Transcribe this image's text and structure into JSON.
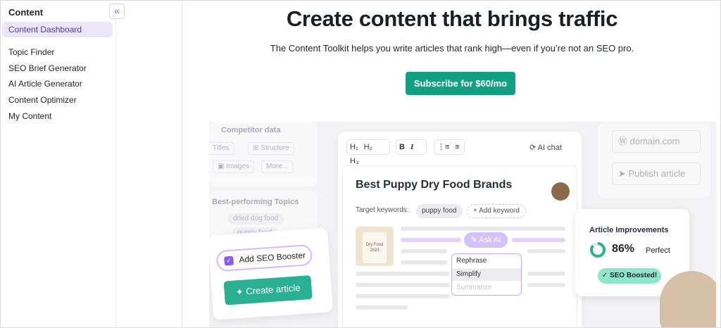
{
  "sidebar": {
    "title": "Content",
    "collapse_icon": "«",
    "active_item": "Content Dashboard",
    "items": [
      "Topic Finder",
      "SEO Brief Generator",
      "AI Article Generator",
      "Content Optimizer",
      "My Content"
    ]
  },
  "hero": {
    "title": "Create content that brings traffic",
    "subtitle": "The Content Toolkit helps you write articles that rank high—even if you’re not an SEO pro.",
    "cta": "Subscribe for $60/mo"
  },
  "illustration": {
    "competitor": {
      "heading": "Competitor data",
      "chips": [
        "Titles",
        "Structure",
        "Images",
        "More..."
      ]
    },
    "topics": {
      "heading": "Best-performing Topics",
      "tags": [
        "dried dog food",
        "puppy food"
      ]
    },
    "booster": {
      "checkbox_label": "Add SEO Booster",
      "button": "Create article"
    },
    "toolbar": {
      "h1": "H₁",
      "h2": "H₂",
      "h3": "H₃",
      "bold": "B",
      "italic": "I",
      "ai_chat": "AI chat"
    },
    "editor": {
      "title": "Best Puppy Dry Food Brands",
      "keywords_label": "Target keywords:",
      "keyword": "puppy food",
      "add_keyword": "+ Add keyword",
      "ask_ai": "Ask AI",
      "menu": [
        "Rephrase",
        "Simplify",
        "Summarize"
      ],
      "image_text": "Dry Food 2023"
    },
    "right": {
      "domain": "domain.com",
      "publish": "Publish article"
    },
    "improvements": {
      "heading": "Article Improvements",
      "score": "86%",
      "score_label": "Perfect",
      "badge": "SEO Boosted!",
      "score_value": 0.86
    }
  },
  "colors": {
    "accent": "#11a081",
    "purple": "#8e5ae6",
    "active_bg": "#ece6fb"
  }
}
